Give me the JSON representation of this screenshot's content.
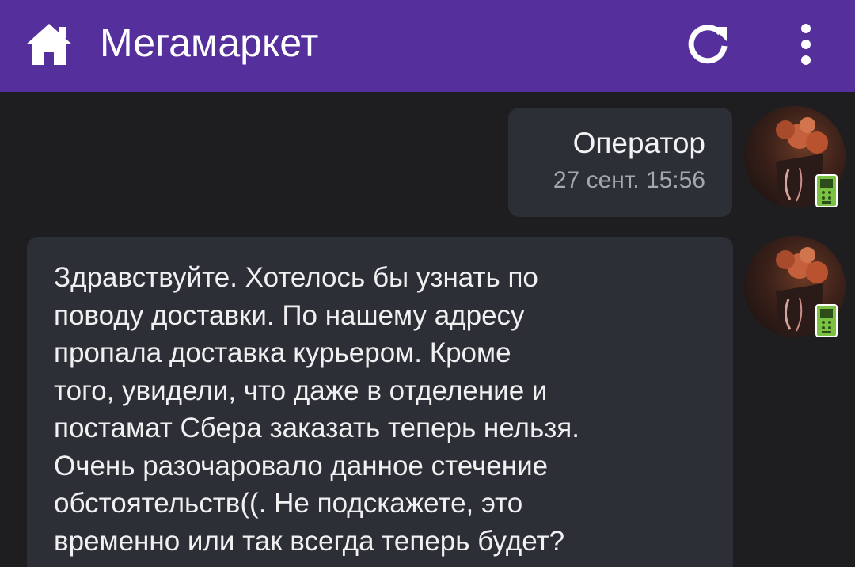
{
  "appbar": {
    "title": "Мегамаркет",
    "color": "#55309c",
    "home_icon": "home-icon",
    "refresh_icon": "refresh-icon",
    "menu_icon": "more-vert-icon"
  },
  "chat": {
    "operator_bubble": {
      "sender": "Оператор",
      "timestamp": "27 сент. 15:56"
    },
    "message_bubble": {
      "lines": [
        "Здравствуйте. Хотелось бы узнать по",
        "поводу доставки. По нашему адресу",
        "пропала доставка курьером. Кроме",
        "того, увидели, что даже в отделение и",
        "постамат Сбера заказать теперь нельзя.",
        "Очень разочаровало данное стечение",
        "обстоятельств((. Не подскажете, это",
        "временно или так всегда теперь будет?"
      ]
    },
    "avatar_badge_icon": "mobile-phone-icon"
  }
}
